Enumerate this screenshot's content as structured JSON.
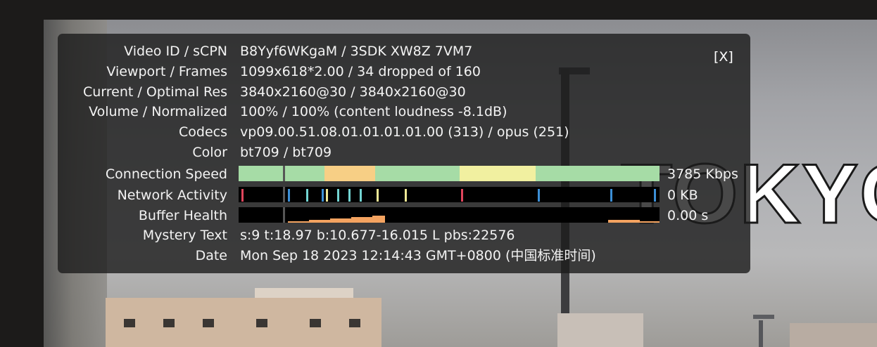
{
  "video": {
    "overlay_text": "TOKYO"
  },
  "stats": {
    "close_label": "[X]",
    "rows": [
      {
        "label": "Video ID / sCPN",
        "value": "B8Yyf6WKgaM / 3SDK XW8Z 7VM7"
      },
      {
        "label": "Viewport / Frames",
        "value": "1099x618*2.00 / 34 dropped of 160"
      },
      {
        "label": "Current / Optimal Res",
        "value": "3840x2160@30 / 3840x2160@30"
      },
      {
        "label": "Volume / Normalized",
        "value": "100% / 100% (content loudness -8.1dB)"
      },
      {
        "label": "Codecs",
        "value": "vp09.00.51.08.01.01.01.01.00 (313) / opus (251)"
      },
      {
        "label": "Color",
        "value": "bt709 / bt709"
      },
      {
        "label": "Connection Speed",
        "value": "3785 Kbps"
      },
      {
        "label": "Network Activity",
        "value": "0 KB"
      },
      {
        "label": "Buffer Health",
        "value": "0.00 s"
      },
      {
        "label": "Mystery Text",
        "value": "s:9 t:18.97 b:10.677-16.015 L pbs:22576"
      },
      {
        "label": "Date",
        "value": "Mon Sep 18 2023 12:14:43 GMT+0800 (中国标准时间)"
      }
    ]
  },
  "colors": {
    "speed_green": "#a6dca6",
    "speed_yellow": "#f1f0a0",
    "speed_orange": "#f7cf85",
    "net_red": "#e0455c",
    "net_blue": "#3c8fd6",
    "net_cyan": "#73d4d2",
    "net_yellow": "#efe896",
    "buffer_orange": "#f4a360"
  }
}
